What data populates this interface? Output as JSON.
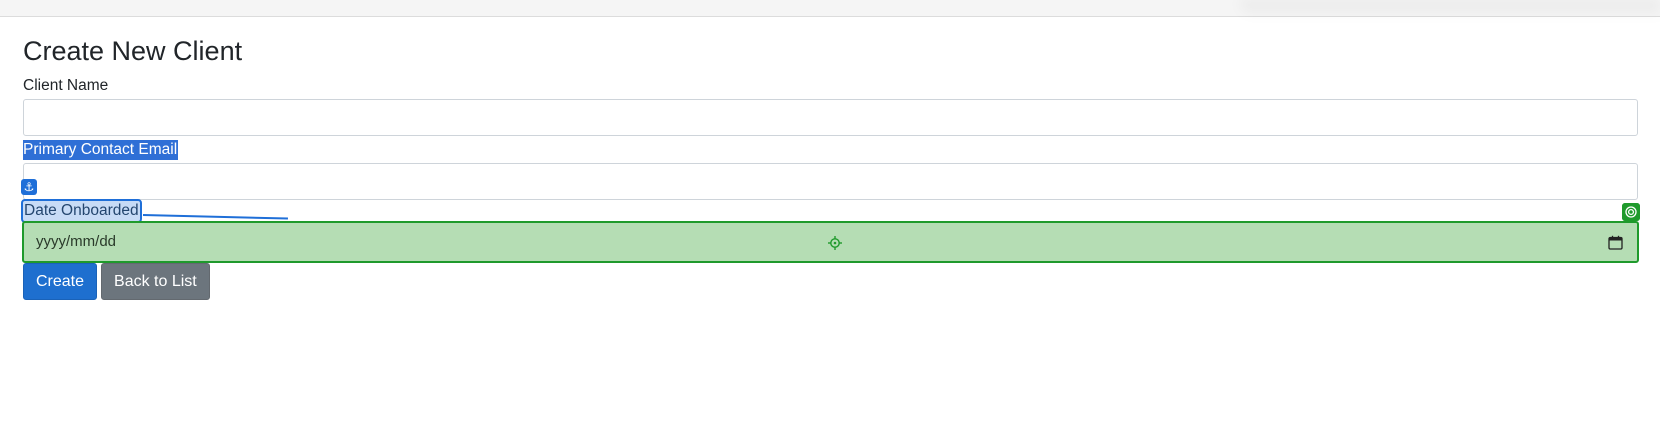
{
  "page": {
    "title": "Create New Client"
  },
  "form": {
    "client_name": {
      "label": "Client Name",
      "value": ""
    },
    "primary_contact_email": {
      "label": "Primary Contact Email",
      "value": ""
    },
    "date_onboarded": {
      "label": "Date Onboarded",
      "placeholder": "yyyy/mm/dd"
    }
  },
  "overlay": {
    "anchor_glyph": "⚓"
  },
  "actions": {
    "create_label": "Create",
    "back_label": "Back to List"
  },
  "icons": {
    "anchor": "anchor-icon",
    "crosshair": "crosshair-icon",
    "calendar": "calendar-icon",
    "target": "target-icon"
  },
  "colors": {
    "primary": "#1e6fcf",
    "secondary": "#6c757d",
    "selection_blue": "#2f6fd6",
    "highlight_green": "#1f9a2c",
    "highlight_green_fill": "#b5ddb4"
  }
}
